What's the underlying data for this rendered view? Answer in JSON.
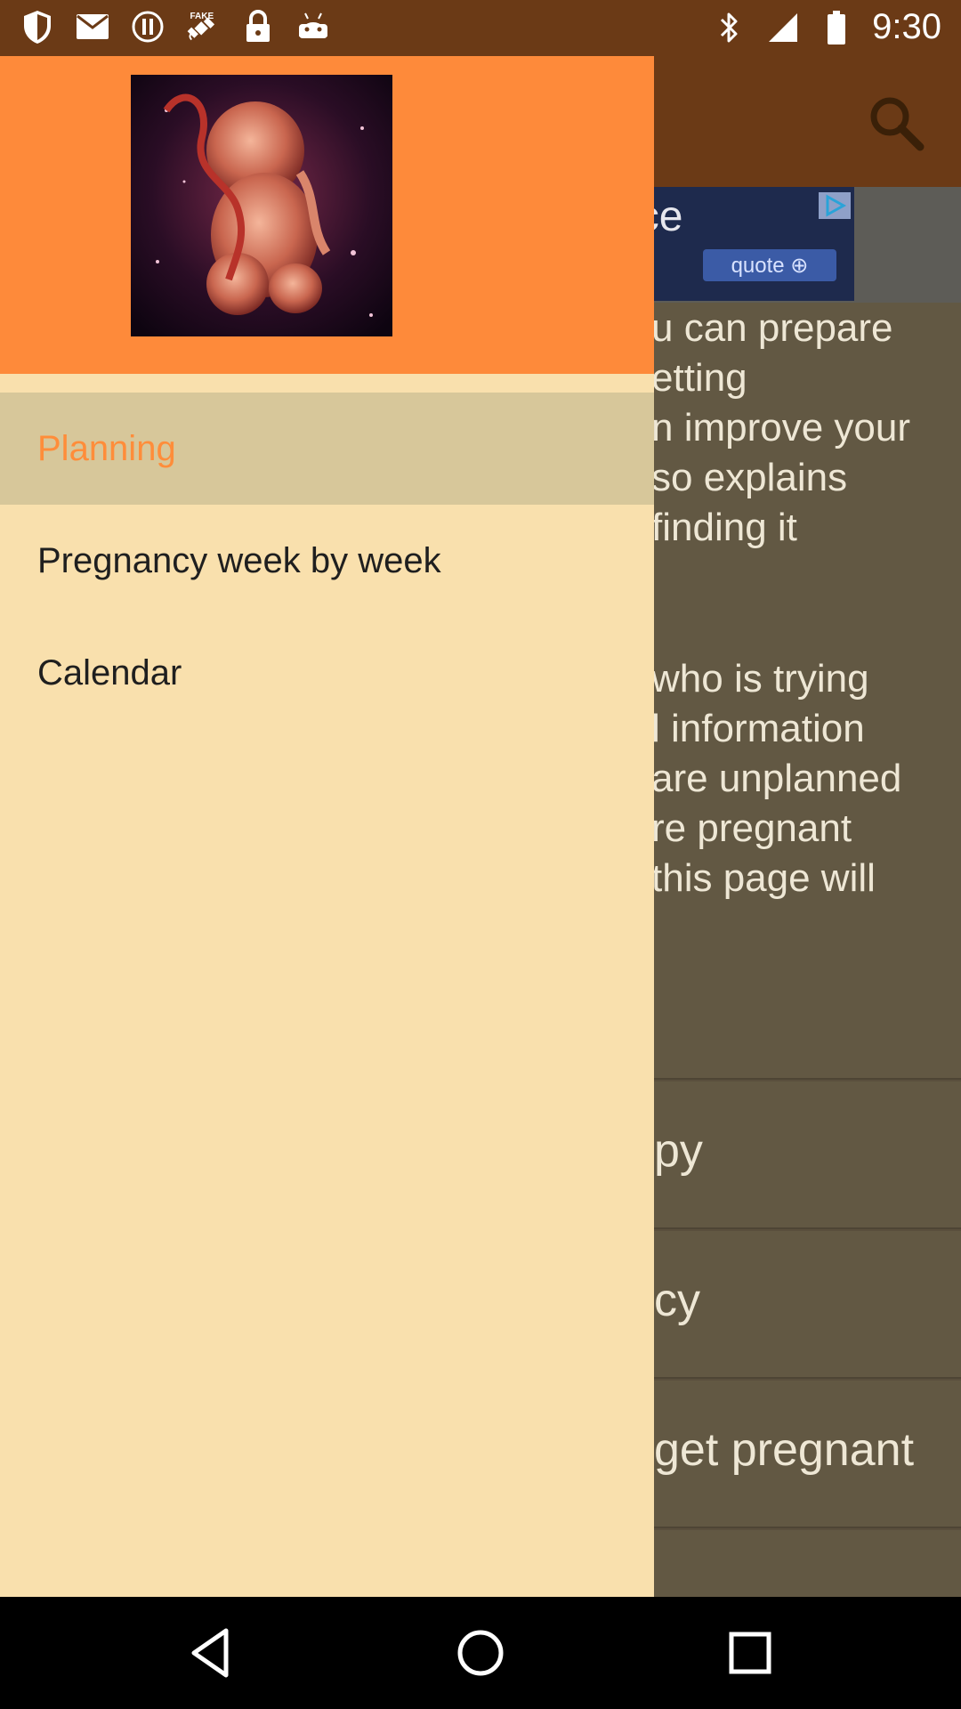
{
  "status_bar": {
    "time": "9:30",
    "left_icons": [
      "shield-icon",
      "mail-icon",
      "alert-icon",
      "satellite-icon",
      "lock-icon",
      "android-icon"
    ],
    "right_icons": [
      "bluetooth-icon",
      "signal-icon",
      "battery-icon"
    ]
  },
  "toolbar": {
    "search_icon": "search-icon"
  },
  "ad": {
    "brand": "esurance",
    "button_label": "quote ⊕"
  },
  "background_content": {
    "paragraph_1": [
      "u can prepare",
      "etting",
      "n improve your",
      "so explains",
      "finding it"
    ],
    "paragraph_2": [
      "who is trying",
      "l information",
      "are unplanned",
      "re pregnant",
      "this page will"
    ],
    "list_items": [
      "py",
      "cy",
      "get pregnant"
    ]
  },
  "drawer": {
    "menu": [
      {
        "label": "Planning",
        "active": true
      },
      {
        "label": "Pregnancy week by week",
        "active": false
      },
      {
        "label": "Calendar",
        "active": false
      }
    ]
  },
  "colors": {
    "header_orange": "#fe8a3a",
    "drawer_bg": "#f9e0ad",
    "active_bg": "#d7c79a",
    "active_text": "#ff8d3a",
    "toolbar_brown": "#6b3a16"
  }
}
